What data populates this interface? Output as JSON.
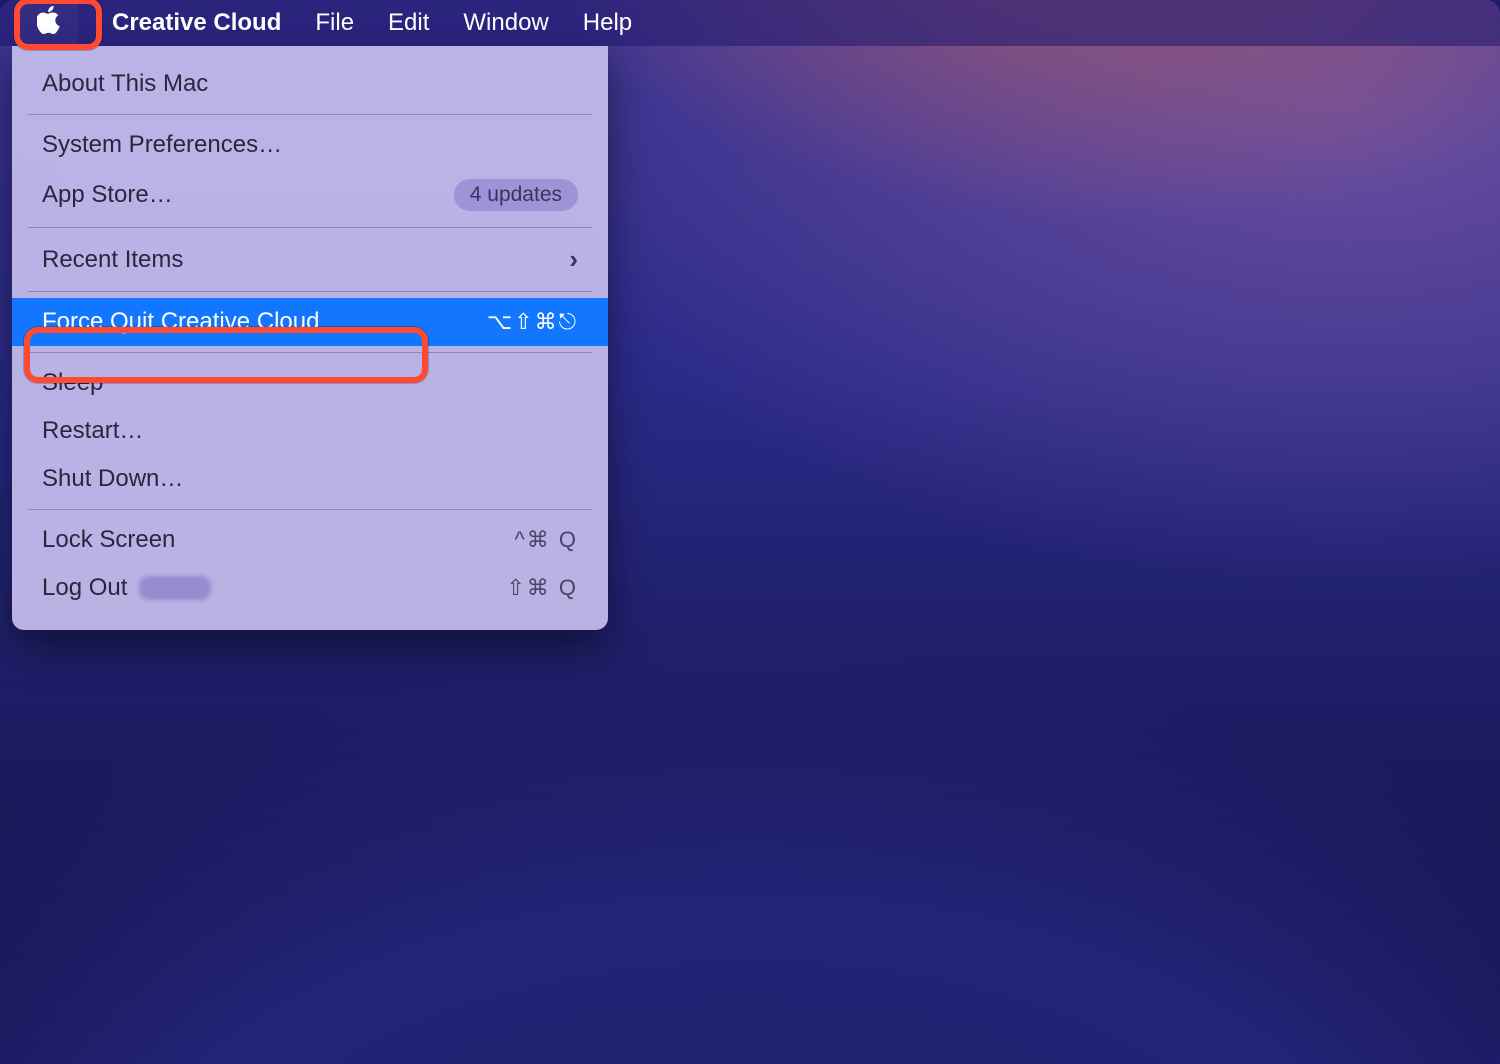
{
  "menubar": {
    "app_name": "Creative Cloud",
    "items": [
      "File",
      "Edit",
      "Window",
      "Help"
    ]
  },
  "apple_menu": {
    "about": "About This Mac",
    "sys_prefs": "System Preferences…",
    "app_store": "App Store…",
    "app_store_badge": "4 updates",
    "recent_items": "Recent Items",
    "force_quit": "Force Quit Creative Cloud",
    "force_quit_shortcut": "⌥⇧⌘⎋",
    "sleep": "Sleep",
    "restart": "Restart…",
    "shut_down": "Shut Down…",
    "lock_screen": "Lock Screen",
    "lock_screen_shortcut": "^⌘ Q",
    "log_out": "Log Out",
    "log_out_shortcut": "⇧⌘ Q"
  },
  "annotations": {
    "apple_highlight": true,
    "force_quit_highlight": true
  }
}
